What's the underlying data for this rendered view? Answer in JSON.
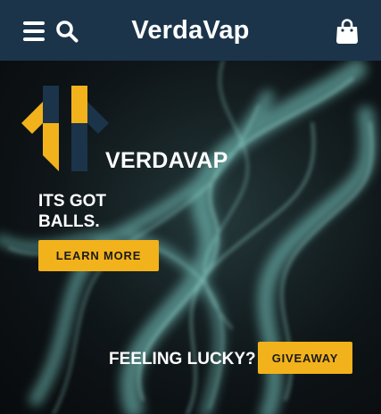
{
  "header": {
    "brand": "VerdaVap",
    "menu_icon": "hamburger-menu-icon",
    "search_icon": "search-icon",
    "cart_icon": "shopping-bag-icon",
    "background_color": "#1b344a"
  },
  "hero": {
    "logo_word": "VERDAVAP",
    "tagline_line1": "ITS GOT",
    "tagline_line2": "BALLS.",
    "learn_more_label": "LEARN MORE",
    "lucky_text": "FEELING LUCKY?",
    "giveaway_label": "GIVEAWAY",
    "accent_color": "#f2b21b",
    "logo_dark_color": "#1b344a"
  }
}
